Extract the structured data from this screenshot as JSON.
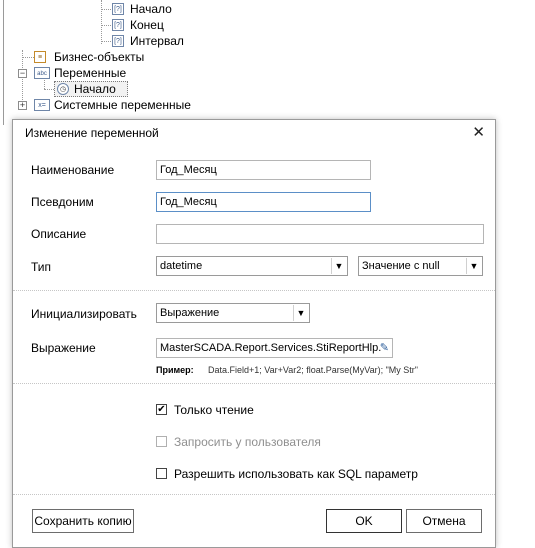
{
  "tree": {
    "items": [
      {
        "label": "Начало",
        "icon": "param-icon"
      },
      {
        "label": "Конец",
        "icon": "param-icon"
      },
      {
        "label": "Интервал",
        "icon": "param-icon"
      },
      {
        "label": "Бизнес-объекты",
        "icon": "business-objects-icon"
      },
      {
        "label": "Переменные",
        "icon": "variables-icon"
      },
      {
        "label": "Начало",
        "icon": "clock-icon"
      },
      {
        "label": "Системные переменные",
        "icon": "system-variables-icon"
      }
    ]
  },
  "dialog": {
    "title": "Изменение переменной",
    "name_label": "Наименование",
    "name_value": "Год_Месяц",
    "alias_label": "Псевдоним",
    "alias_value": "Год_Месяц",
    "description_label": "Описание",
    "description_value": "",
    "type_label": "Тип",
    "type_value": "datetime",
    "nullable_value": "Значение с null",
    "init_label": "Инициализировать",
    "init_value": "Выражение",
    "expression_label": "Выражение",
    "expression_value": "MasterSCADA.Report.Services.StiReportHlp.",
    "example_label": "Пример:",
    "example_text": "Data.Field+1; Var+Var2; float.Parse(MyVar); \"My Str\"",
    "readonly_label": "Только чтение",
    "readonly_checked": true,
    "ask_user_label": "Запросить у пользователя",
    "ask_user_checked": false,
    "sql_param_label": "Разрешить использовать как SQL параметр",
    "sql_param_checked": false,
    "save_copy_label": "Сохранить копию",
    "ok_label": "OK",
    "cancel_label": "Отмена"
  },
  "colors": {
    "focus_border": "#5b8fc7",
    "disabled_text": "#8f8f8f"
  }
}
